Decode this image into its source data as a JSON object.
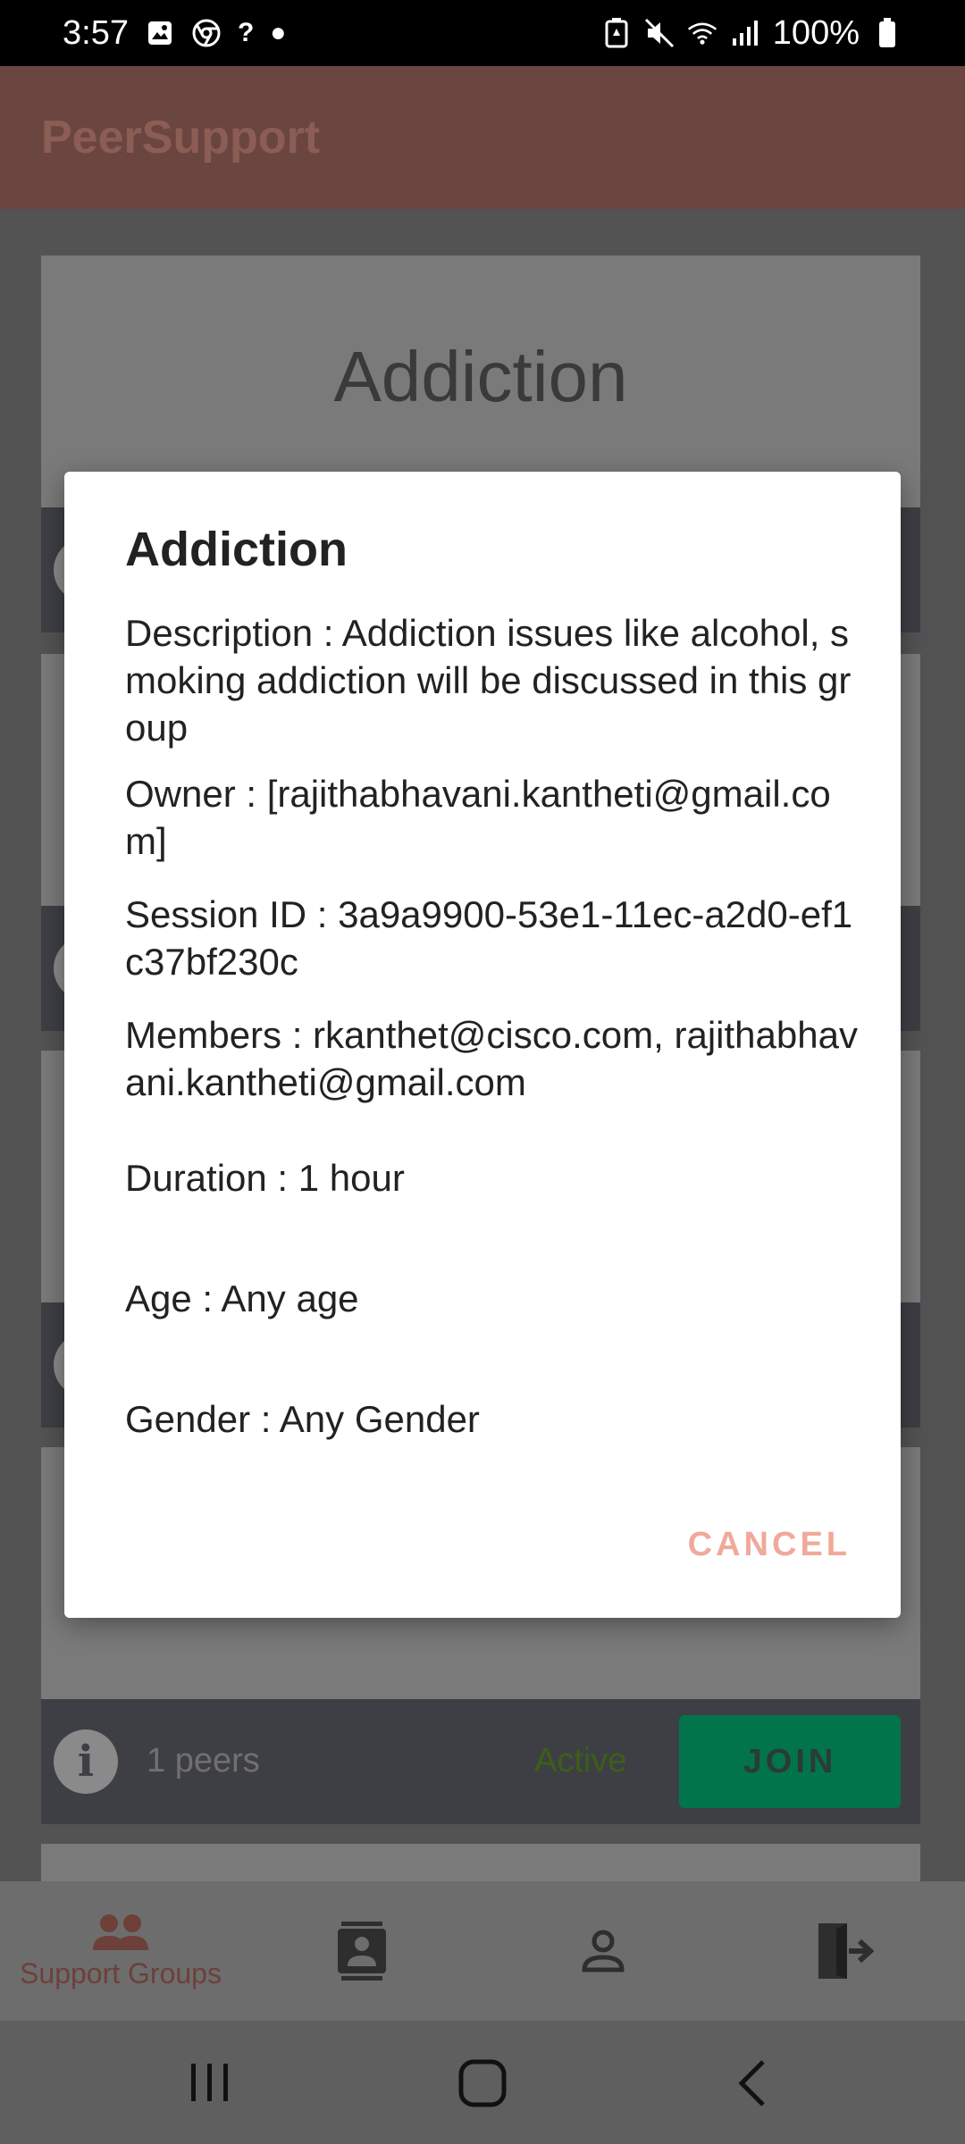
{
  "status_bar": {
    "time": "3:57",
    "question": "?",
    "battery": "100%"
  },
  "app_bar": {
    "title": "PeerSupport"
  },
  "card": {
    "title": "Addiction"
  },
  "group_footer": {
    "peers": "1 peers",
    "status": "Active",
    "join_label": "JOIN"
  },
  "dialog": {
    "title": "Addiction",
    "description": "Description : Addiction issues like alcohol, smoking addiction will be discussed in this group",
    "owner": "Owner : [rajithabhavani.kantheti@gmail.com]",
    "session": "Session ID : 3a9a9900-53e1-11ec-a2d0-ef1c37bf230c",
    "members": "Members : rkanthet@cisco.com, rajithabhavani.kantheti@gmail.com",
    "duration": "Duration : 1 hour",
    "age": "Age : Any age",
    "gender": "Gender : Any Gender",
    "cancel_label": "CANCEL"
  },
  "bottom_nav": {
    "items": [
      {
        "label": "Support Groups",
        "icon": "groups-icon"
      },
      {
        "label": "",
        "icon": "contacts-icon"
      },
      {
        "label": "",
        "icon": "person-icon"
      },
      {
        "label": "",
        "icon": "logout-icon"
      }
    ]
  },
  "colors": {
    "accent": "#e57363",
    "join": "#02744b",
    "active": "#5aa51c"
  }
}
